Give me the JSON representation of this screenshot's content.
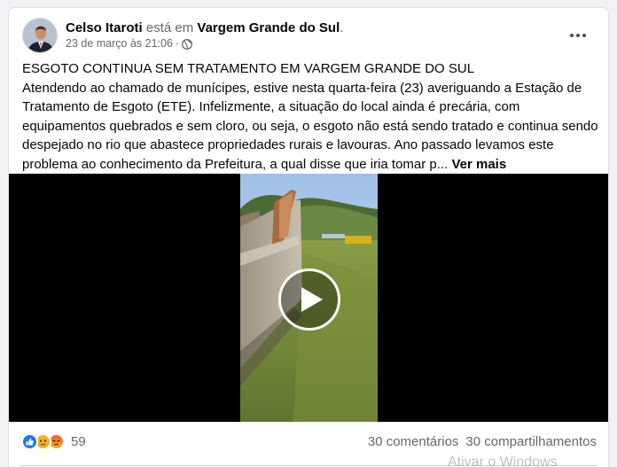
{
  "post": {
    "author": "Celso Itaroti",
    "verb": "está em",
    "place": "Vargem Grande do Sul",
    "place_suffix": ".",
    "date": "23 de março às 21:06",
    "separator": "·",
    "title": "ESGOTO CONTINUA SEM TRATAMENTO EM VARGEM GRANDE DO SUL",
    "body": "Atendendo ao chamado de munícipes, estive nesta quarta-feira (23) averiguando a Estação de Tratamento de Esgoto (ETE). Infelizmente, a situação do local ainda é precária, com equipamentos quebrados e sem cloro, ou seja, o esgoto não está sendo tratado e continua sendo despejado no rio que abastece propriedades rurais e lavouras. Ano passado levamos este problema ao conhecimento da Prefeitura, a qual disse que iria tomar p...",
    "see_more": "Ver mais"
  },
  "reactions": {
    "icons": [
      "like-icon",
      "sad-icon",
      "angry-icon"
    ],
    "count": "59",
    "comments": "30 comentários",
    "shares": "30 compartilhamentos"
  },
  "watermark": "Ativar o Windows",
  "colors": {
    "background": "#f0f2f5",
    "card": "#ffffff",
    "text": "#050505",
    "secondary_text": "#65676b",
    "like": "#1877f2",
    "sad": "#f7b125",
    "angry": "#f05c2c"
  }
}
